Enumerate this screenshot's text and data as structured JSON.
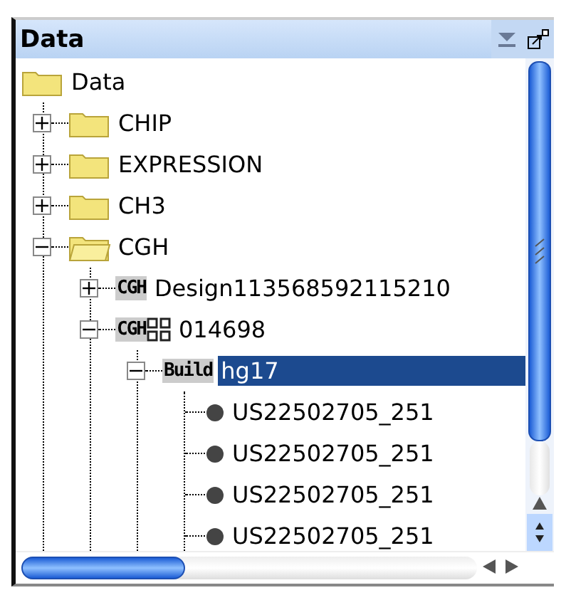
{
  "panel": {
    "title": "Data"
  },
  "tree": [
    {
      "label": "Data",
      "kind": "folder",
      "children": [
        {
          "label": "CHIP",
          "kind": "folder",
          "expanded": false
        },
        {
          "label": "EXPRESSION",
          "kind": "folder",
          "expanded": false
        },
        {
          "label": "CH3",
          "kind": "folder",
          "expanded": false
        },
        {
          "label": "CGH",
          "kind": "folder",
          "expanded": true,
          "children": [
            {
              "label": "Design113568592115210",
              "kind": "design",
              "badge": "CGH",
              "expanded": false
            },
            {
              "label": "014698",
              "kind": "array",
              "badge": "CGH",
              "expanded": true,
              "children": [
                {
                  "label": "hg17",
                  "kind": "build",
                  "badge": "Build",
                  "expanded": true,
                  "selected": true,
                  "children": [
                    {
                      "label": "US22502705_251",
                      "kind": "sample",
                      "selected": false
                    },
                    {
                      "label": "US22502705_251",
                      "kind": "sample",
                      "selected": false
                    },
                    {
                      "label": "US22502705_251",
                      "kind": "sample",
                      "selected": false
                    },
                    {
                      "label": "US22502705_251",
                      "kind": "sample",
                      "selected": false
                    }
                  ]
                }
              ]
            }
          ]
        }
      ]
    }
  ]
}
